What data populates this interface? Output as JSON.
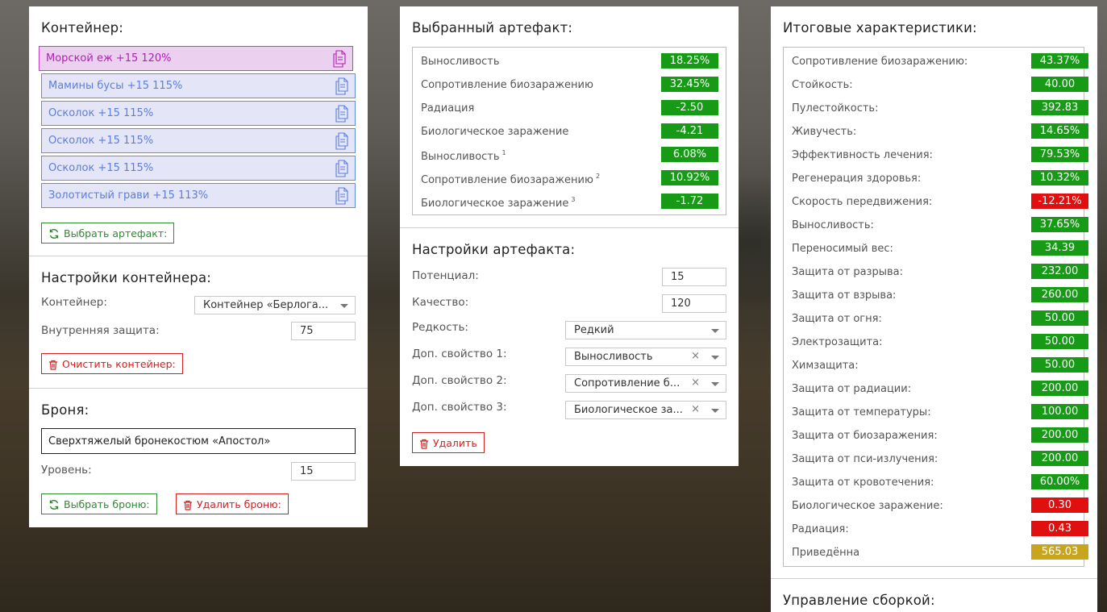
{
  "colors": {
    "green": "#179b17",
    "red": "#e01010",
    "gold": "#c9a51d",
    "slot_active": "#b21fb5",
    "slot_normal": "#5a7fdd"
  },
  "container": {
    "title": "Контейнер:",
    "slots": [
      {
        "label": "Морской еж +15 120%",
        "active": true,
        "icon": "copy-icon"
      },
      {
        "label": "Мамины бусы +15 115%",
        "active": false,
        "icon": "copy-icon"
      },
      {
        "label": "Осколок +15 115%",
        "active": false,
        "icon": "copy-icon"
      },
      {
        "label": "Осколок +15 115%",
        "active": false,
        "icon": "copy-icon"
      },
      {
        "label": "Осколок +15 115%",
        "active": false,
        "icon": "copy-icon"
      },
      {
        "label": "Золотистый грави +15 113%",
        "active": false,
        "icon": "copy-icon"
      }
    ],
    "choose_button": "Выбрать артефакт:"
  },
  "container_settings": {
    "title": "Настройки контейнера:",
    "container_label": "Контейнер:",
    "container_value": "Контейнер «Берлога...",
    "protection_label": "Внутренняя защита:",
    "protection_value": "75",
    "clear_button": "Очистить контейнер:"
  },
  "armor": {
    "title": "Броня:",
    "name": "Сверхтяжелый бронекостюм «Апостол»",
    "level_label": "Уровень:",
    "level_value": "15",
    "choose_button": "Выбрать броню:",
    "delete_button": "Удалить броню:"
  },
  "selected": {
    "title": "Выбранный артефакт:",
    "stats": [
      {
        "name": "Выносливость",
        "sup": "",
        "value": "18.25%",
        "color": "green"
      },
      {
        "name": "Сопротивление биозаражению",
        "sup": "",
        "value": "32.45%",
        "color": "green"
      },
      {
        "name": "Радиация",
        "sup": "",
        "value": "-2.50",
        "color": "green"
      },
      {
        "name": "Биологическое заражение",
        "sup": "",
        "value": "-4.21",
        "color": "green"
      },
      {
        "name": "Выносливость",
        "sup": "1",
        "value": "6.08%",
        "color": "green"
      },
      {
        "name": "Сопротивление биозаражению",
        "sup": "2",
        "value": "10.92%",
        "color": "green"
      },
      {
        "name": "Биологическое заражение",
        "sup": "3",
        "value": "-1.72",
        "color": "green"
      }
    ]
  },
  "artifact_settings": {
    "title": "Настройки артефакта:",
    "potential_label": "Потенциал:",
    "potential_value": "15",
    "quality_label": "Качество:",
    "quality_value": "120",
    "rarity_label": "Редкость:",
    "rarity_value": "Редкий",
    "prop1_label": "Доп. свойство 1:",
    "prop1_value": "Выносливость",
    "prop2_label": "Доп. свойство 2:",
    "prop2_value": "Сопротивление б...",
    "prop3_label": "Доп. свойство 3:",
    "prop3_value": "Биологическое за...",
    "clear_symbol": "×",
    "delete_button": "Удалить"
  },
  "totals": {
    "title": "Итоговые характеристики:",
    "stats": [
      {
        "name": "Сопротивление биозаражению:",
        "value": "43.37%",
        "color": "green"
      },
      {
        "name": "Стойкость:",
        "value": "40.00",
        "color": "green"
      },
      {
        "name": "Пулестойкость:",
        "value": "392.83",
        "color": "green"
      },
      {
        "name": "Живучесть:",
        "value": "14.65%",
        "color": "green"
      },
      {
        "name": "Эффективность лечения:",
        "value": "79.53%",
        "color": "green"
      },
      {
        "name": "Регенерация здоровья:",
        "value": "10.32%",
        "color": "green"
      },
      {
        "name": "Скорость передвижения:",
        "value": "-12.21%",
        "color": "red"
      },
      {
        "name": "Выносливость:",
        "value": "37.65%",
        "color": "green"
      },
      {
        "name": "Переносимый вес:",
        "value": "34.39",
        "color": "green"
      },
      {
        "name": "Защита от разрыва:",
        "value": "232.00",
        "color": "green"
      },
      {
        "name": "Защита от взрыва:",
        "value": "260.00",
        "color": "green"
      },
      {
        "name": "Защита от огня:",
        "value": "50.00",
        "color": "green"
      },
      {
        "name": "Электрозащита:",
        "value": "50.00",
        "color": "green"
      },
      {
        "name": "Химзащита:",
        "value": "50.00",
        "color": "green"
      },
      {
        "name": "Защита от радиации:",
        "value": "200.00",
        "color": "green"
      },
      {
        "name": "Защита от температуры:",
        "value": "100.00",
        "color": "green"
      },
      {
        "name": "Защита от биозаражения:",
        "value": "200.00",
        "color": "green"
      },
      {
        "name": "Защита от пси-излучения:",
        "value": "200.00",
        "color": "green"
      },
      {
        "name": "Защита от кровотечения:",
        "value": "60.00%",
        "color": "green"
      },
      {
        "name": "Биологическое заражение:",
        "value": "0.30",
        "color": "red"
      },
      {
        "name": "Радиация:",
        "value": "0.43",
        "color": "red"
      },
      {
        "name": "Приведённа",
        "value": "565.03",
        "color": "gold"
      }
    ]
  },
  "build": {
    "title": "Управление сборкой:"
  }
}
